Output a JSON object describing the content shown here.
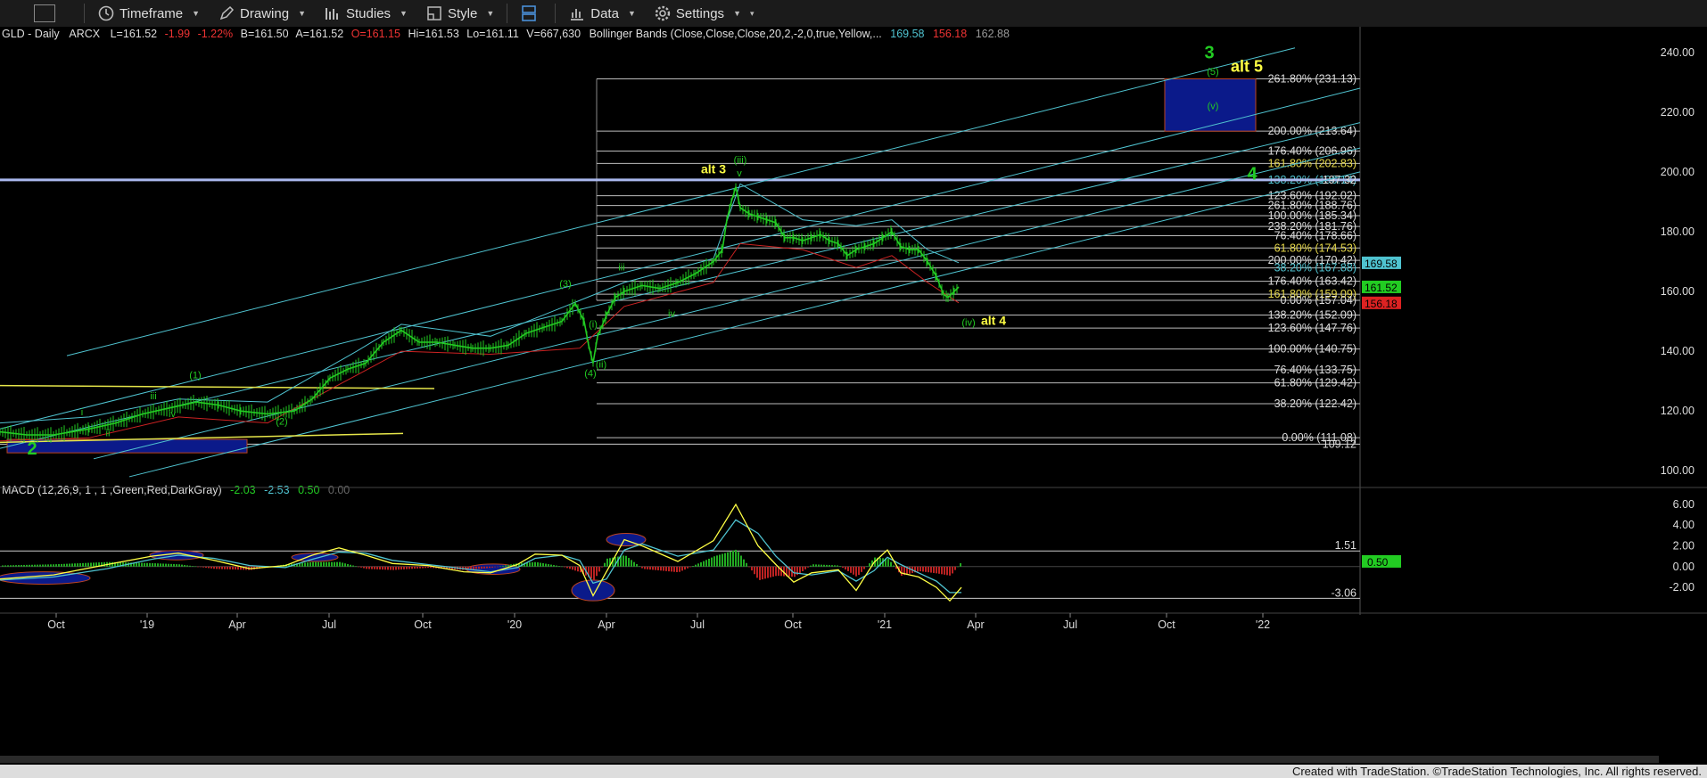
{
  "toolbar": {
    "timeframe": "Timeframe",
    "drawing": "Drawing",
    "studies": "Studies",
    "style": "Style",
    "data": "Data",
    "settings": "Settings"
  },
  "header": {
    "symbol": "GLD - Daily",
    "exchange": "ARCX",
    "last": "L=161.52",
    "change": "-1.99",
    "pct": "-1.22%",
    "bid": "B=161.50",
    "ask": "A=161.52",
    "open": "O=161.15",
    "high": "Hi=161.53",
    "low": "Lo=161.11",
    "volume": "V=667,630",
    "study": "Bollinger Bands (Close,Close,Close,20,2,-2,0,true,Yellow,...",
    "bb_upper": "169.58",
    "bb_lower": "156.18",
    "bb_mid": "162.88"
  },
  "macd_header": {
    "label": "MACD (12,26,9, 1 , 1 ,Green,Red,DarkGray)",
    "v1": "-2.03",
    "v2": "-2.53",
    "v3": "0.50",
    "v4": "0.00"
  },
  "footer": "Created with TradeStation. ©TradeStation Technologies, Inc. All rights reserved.",
  "colors": {
    "green": "#22cc22",
    "red": "#dd2222",
    "cyan": "#4fc3d0",
    "yellow": "#ffff44",
    "blue_box": "#0b1a8a"
  },
  "chart_data": [
    {
      "type": "line",
      "ylim": [
        95,
        245
      ],
      "yticks": [
        100,
        120,
        140,
        160,
        180,
        200,
        220,
        240
      ],
      "xticks": [
        "Oct",
        "'19",
        "Apr",
        "Jul",
        "Oct",
        "'20",
        "Apr",
        "Jul",
        "Oct",
        "'21",
        "Apr",
        "Jul",
        "Oct",
        "'22"
      ],
      "price_points": [
        [
          0,
          113
        ],
        [
          30,
          112
        ],
        [
          60,
          112
        ],
        [
          100,
          114
        ],
        [
          130,
          116
        ],
        [
          160,
          119
        ],
        [
          190,
          121
        ],
        [
          220,
          123
        ],
        [
          245,
          122
        ],
        [
          270,
          120
        ],
        [
          300,
          119
        ],
        [
          330,
          120
        ],
        [
          350,
          124
        ],
        [
          370,
          131
        ],
        [
          390,
          134
        ],
        [
          410,
          136
        ],
        [
          430,
          143
        ],
        [
          450,
          147
        ],
        [
          470,
          143
        ],
        [
          490,
          143
        ],
        [
          510,
          142
        ],
        [
          530,
          141
        ],
        [
          550,
          141
        ],
        [
          570,
          142
        ],
        [
          590,
          146
        ],
        [
          610,
          148
        ],
        [
          630,
          150
        ],
        [
          645,
          156
        ],
        [
          655,
          150
        ],
        [
          660,
          142
        ],
        [
          665,
          136
        ],
        [
          670,
          145
        ],
        [
          680,
          152
        ],
        [
          690,
          158
        ],
        [
          700,
          160
        ],
        [
          720,
          162
        ],
        [
          740,
          161
        ],
        [
          760,
          163
        ],
        [
          780,
          166
        ],
        [
          800,
          170
        ],
        [
          810,
          174
        ],
        [
          815,
          184
        ],
        [
          820,
          190
        ],
        [
          825,
          195
        ],
        [
          830,
          188
        ],
        [
          840,
          186
        ],
        [
          850,
          185
        ],
        [
          860,
          184
        ],
        [
          870,
          183
        ],
        [
          880,
          178
        ],
        [
          890,
          178
        ],
        [
          900,
          177
        ],
        [
          910,
          178
        ],
        [
          920,
          179
        ],
        [
          930,
          177
        ],
        [
          940,
          176
        ],
        [
          950,
          172
        ],
        [
          960,
          174
        ],
        [
          970,
          175
        ],
        [
          980,
          176
        ],
        [
          990,
          178
        ],
        [
          1000,
          180
        ],
        [
          1010,
          175
        ],
        [
          1020,
          174
        ],
        [
          1030,
          174
        ],
        [
          1040,
          170
        ],
        [
          1050,
          165
        ],
        [
          1058,
          159
        ],
        [
          1063,
          158
        ],
        [
          1070,
          160
        ],
        [
          1075,
          161.5
        ]
      ],
      "bb_upper_points": [
        [
          0,
          116
        ],
        [
          100,
          118
        ],
        [
          200,
          124
        ],
        [
          300,
          123
        ],
        [
          400,
          140
        ],
        [
          450,
          149
        ],
        [
          550,
          145
        ],
        [
          650,
          157
        ],
        [
          700,
          163
        ],
        [
          800,
          171
        ],
        [
          830,
          196
        ],
        [
          900,
          184
        ],
        [
          960,
          182
        ],
        [
          1000,
          184
        ],
        [
          1040,
          174
        ],
        [
          1075,
          169.6
        ]
      ],
      "bb_lower_points": [
        [
          0,
          110
        ],
        [
          100,
          111
        ],
        [
          200,
          118
        ],
        [
          300,
          116
        ],
        [
          400,
          132
        ],
        [
          450,
          140
        ],
        [
          550,
          139
        ],
        [
          650,
          141
        ],
        [
          700,
          155
        ],
        [
          800,
          163
        ],
        [
          830,
          176
        ],
        [
          900,
          174
        ],
        [
          960,
          168
        ],
        [
          1000,
          172
        ],
        [
          1040,
          163
        ],
        [
          1075,
          156.2
        ]
      ],
      "right_price_labels": [
        {
          "price": 169.58,
          "text": "169.58",
          "bg": "#4fc3d0",
          "fg": "#000"
        },
        {
          "price": 161.52,
          "text": "161.52",
          "bg": "#22cc22",
          "fg": "#000"
        },
        {
          "price": 156.18,
          "text": "156.18",
          "bg": "#dd2222",
          "fg": "#000"
        }
      ],
      "fib_levels": [
        {
          "text": "261.80% (231.13)",
          "price": 231.13,
          "color": "#ddd"
        },
        {
          "text": "200.00% (213.64)",
          "price": 213.64,
          "color": "#ddd"
        },
        {
          "text": "176.40% (206.96)",
          "price": 206.96,
          "color": "#ddd"
        },
        {
          "text": "161.80% (202.83)",
          "price": 202.83,
          "color": "#e6d84a"
        },
        {
          "text": "138.20% (196.14)",
          "price": 197.32,
          "color": "#4fc3d0"
        },
        {
          "text": "123.60% (192.02)",
          "price": 192.02,
          "color": "#ddd"
        },
        {
          "text": "261.80% (188.76)",
          "price": 188.76,
          "color": "#ddd"
        },
        {
          "text": "100.00% (185.34)",
          "price": 185.34,
          "color": "#ddd"
        },
        {
          "text": "238.20% (181.76)",
          "price": 181.76,
          "color": "#ddd"
        },
        {
          "text": "76.40% (178.66)",
          "price": 178.66,
          "color": "#ddd"
        },
        {
          "text": "61.80% (174.53)",
          "price": 174.53,
          "color": "#e6d84a"
        },
        {
          "text": "200.00% (170.42)",
          "price": 170.42,
          "color": "#ddd"
        },
        {
          "text": "38.20% (167.88)",
          "price": 167.88,
          "color": "#4fc3d0"
        },
        {
          "text": "176.40% (163.42)",
          "price": 163.42,
          "color": "#ddd"
        },
        {
          "text": "161.80% (159.09)",
          "price": 159.09,
          "color": "#e6d84a"
        },
        {
          "text": "0.00% (157.04)",
          "price": 157.04,
          "color": "#ddd"
        },
        {
          "text": "138.20% (152.09)",
          "price": 152.09,
          "color": "#ddd"
        },
        {
          "text": "123.60% (147.76)",
          "price": 147.76,
          "color": "#ddd"
        },
        {
          "text": "100.00% (140.75)",
          "price": 140.75,
          "color": "#ddd"
        },
        {
          "text": "76.40% (133.75)",
          "price": 133.75,
          "color": "#ddd"
        },
        {
          "text": "61.80% (129.42)",
          "price": 129.42,
          "color": "#ddd"
        },
        {
          "text": "38.20% (122.42)",
          "price": 122.42,
          "color": "#ddd"
        },
        {
          "text": "0.00% (111.08)",
          "price": 111.08,
          "color": "#ddd"
        }
      ],
      "level_197": "197.32",
      "level_109": "109.12",
      "wave_labels": [
        {
          "t": "3",
          "x": 1356,
          "p": 238,
          "c": "#22cc22",
          "s": 20,
          "w": "bold"
        },
        {
          "t": "(5)",
          "x": 1360,
          "p": 232.5,
          "c": "#22cc22",
          "s": 11
        },
        {
          "t": "alt 5",
          "x": 1398,
          "p": 233.5,
          "c": "#ffff44",
          "s": 18,
          "w": "bold"
        },
        {
          "t": "(v)",
          "x": 1360,
          "p": 221,
          "c": "#22cc22",
          "s": 11
        },
        {
          "t": "4",
          "x": 1404,
          "p": 197.5,
          "c": "#22cc22",
          "s": 20,
          "w": "bold"
        },
        {
          "t": "alt 3",
          "x": 800,
          "p": 199.5,
          "c": "#ffff44",
          "s": 14,
          "w": "bold"
        },
        {
          "t": "(iii)",
          "x": 830,
          "p": 203,
          "c": "#22cc22",
          "s": 11
        },
        {
          "t": "v",
          "x": 829,
          "p": 198.5,
          "c": "#22cc22",
          "s": 11
        },
        {
          "t": "iii",
          "x": 697,
          "p": 167,
          "c": "#22cc22",
          "s": 11
        },
        {
          "t": "(3)",
          "x": 634,
          "p": 161.5,
          "c": "#22cc22",
          "s": 11
        },
        {
          "t": "(i)",
          "x": 665,
          "p": 148,
          "c": "#22cc22",
          "s": 11
        },
        {
          "t": "iv",
          "x": 753,
          "p": 151.5,
          "c": "#22cc22",
          "s": 11
        },
        {
          "t": "(ii)",
          "x": 674,
          "p": 134.5,
          "c": "#22cc22",
          "s": 11
        },
        {
          "t": "(4)",
          "x": 662,
          "p": 131.5,
          "c": "#22cc22",
          "s": 11
        },
        {
          "t": "(iv)",
          "x": 1086,
          "p": 148.5,
          "c": "#22cc22",
          "s": 11
        },
        {
          "t": "alt 4",
          "x": 1114,
          "p": 148.8,
          "c": "#ffff44",
          "s": 14,
          "w": "bold"
        },
        {
          "t": "(1)",
          "x": 219,
          "p": 131,
          "c": "#22cc22",
          "s": 11
        },
        {
          "t": "iii",
          "x": 172,
          "p": 124,
          "c": "#22cc22",
          "s": 11
        },
        {
          "t": "iv",
          "x": 193,
          "p": 118,
          "c": "#22cc22",
          "s": 11
        },
        {
          "t": "i",
          "x": 92,
          "p": 118.5,
          "c": "#22cc22",
          "s": 11
        },
        {
          "t": "ii",
          "x": 121,
          "p": 111.5,
          "c": "#22cc22",
          "s": 11
        },
        {
          "t": "(2)",
          "x": 316,
          "p": 115.5,
          "c": "#22cc22",
          "s": 11
        },
        {
          "t": "2",
          "x": 36,
          "p": 105.5,
          "c": "#22cc22",
          "s": 20,
          "w": "bold"
        }
      ],
      "channels": [
        {
          "x1": 75,
          "p1": 138.5,
          "x2": 1452,
          "p2": 241.5
        },
        {
          "x1": 0,
          "p1": 114,
          "x2": 1525,
          "p2": 228
        },
        {
          "x1": 0,
          "p1": 107.5,
          "x2": 1525,
          "p2": 216.5
        },
        {
          "x1": 105,
          "p1": 104,
          "x2": 1525,
          "p2": 208
        },
        {
          "x1": 145,
          "p1": 98,
          "x2": 1525,
          "p2": 200
        }
      ],
      "yellow_lines": [
        {
          "x1": 0,
          "p1": 128.5,
          "x2": 487,
          "p2": 127.5
        },
        {
          "x1": 0,
          "p1": 109.5,
          "x2": 452,
          "p2": 112.5
        }
      ],
      "boxes": [
        {
          "x1": 1306,
          "p1": 231.13,
          "x2": 1408,
          "p2": 213.64
        },
        {
          "x1": 8,
          "p1": 110.5,
          "x2": 277,
          "p2": 106
        }
      ]
    },
    {
      "type": "line",
      "ylim": [
        -3.8,
        7.2
      ],
      "yticks": [
        6,
        4,
        2,
        0,
        -2
      ],
      "ytick_labels": [
        "6.00",
        "4.00",
        "2.00",
        "0.00",
        "-2.00"
      ],
      "ref_upper": "1.51",
      "ref_lower": "-3.06",
      "last_value": "0.50",
      "macd_points": [
        [
          0,
          -1.2
        ],
        [
          60,
          -0.8
        ],
        [
          120,
          0.2
        ],
        [
          170,
          1.0
        ],
        [
          200,
          1.3
        ],
        [
          240,
          0.6
        ],
        [
          280,
          -0.2
        ],
        [
          320,
          0.1
        ],
        [
          350,
          1.1
        ],
        [
          380,
          1.8
        ],
        [
          410,
          1.1
        ],
        [
          440,
          0.3
        ],
        [
          480,
          0.1
        ],
        [
          520,
          -0.5
        ],
        [
          550,
          -0.6
        ],
        [
          580,
          0.2
        ],
        [
          600,
          1.2
        ],
        [
          630,
          1.1
        ],
        [
          650,
          0.1
        ],
        [
          665,
          -2.8
        ],
        [
          680,
          -0.5
        ],
        [
          700,
          2.6
        ],
        [
          720,
          2.0
        ],
        [
          760,
          0.5
        ],
        [
          800,
          2.5
        ],
        [
          825,
          6.0
        ],
        [
          850,
          2.0
        ],
        [
          870,
          0.2
        ],
        [
          890,
          -1.5
        ],
        [
          910,
          -0.6
        ],
        [
          940,
          -0.3
        ],
        [
          960,
          -2.3
        ],
        [
          980,
          0.4
        ],
        [
          995,
          1.6
        ],
        [
          1010,
          -0.6
        ],
        [
          1030,
          -1.0
        ],
        [
          1050,
          -2.0
        ],
        [
          1065,
          -3.3
        ],
        [
          1078,
          -2.0
        ]
      ],
      "signal_points": [
        [
          0,
          -1.3
        ],
        [
          60,
          -1.0
        ],
        [
          120,
          -0.2
        ],
        [
          170,
          0.7
        ],
        [
          200,
          1.1
        ],
        [
          240,
          0.8
        ],
        [
          280,
          0.1
        ],
        [
          320,
          -0.1
        ],
        [
          350,
          0.7
        ],
        [
          380,
          1.4
        ],
        [
          410,
          1.3
        ],
        [
          440,
          0.6
        ],
        [
          480,
          0.2
        ],
        [
          520,
          -0.2
        ],
        [
          550,
          -0.5
        ],
        [
          580,
          -0.1
        ],
        [
          600,
          0.8
        ],
        [
          630,
          1.1
        ],
        [
          650,
          0.6
        ],
        [
          665,
          -1.6
        ],
        [
          680,
          -1.2
        ],
        [
          700,
          1.6
        ],
        [
          720,
          2.2
        ],
        [
          760,
          1.0
        ],
        [
          800,
          1.6
        ],
        [
          825,
          4.5
        ],
        [
          850,
          3.2
        ],
        [
          870,
          1.0
        ],
        [
          890,
          -0.6
        ],
        [
          910,
          -0.8
        ],
        [
          940,
          -0.4
        ],
        [
          960,
          -1.4
        ],
        [
          980,
          -0.4
        ],
        [
          995,
          0.9
        ],
        [
          1010,
          0.2
        ],
        [
          1030,
          -0.6
        ],
        [
          1050,
          -1.4
        ],
        [
          1065,
          -2.5
        ],
        [
          1078,
          -2.5
        ]
      ],
      "ellipses": [
        {
          "cx": 49,
          "v": -1.1,
          "rx": 52,
          "rv": 0.6
        },
        {
          "cx": 198,
          "v": 1.1,
          "rx": 30,
          "rv": 0.45
        },
        {
          "cx": 353,
          "v": 0.9,
          "rx": 26,
          "rv": 0.4
        },
        {
          "cx": 553,
          "v": -0.25,
          "rx": 30,
          "rv": 0.5
        },
        {
          "cx": 665,
          "v": -2.3,
          "rx": 24,
          "rv": 1.0
        },
        {
          "cx": 702,
          "v": 2.6,
          "rx": 22,
          "rv": 0.6
        }
      ]
    }
  ]
}
